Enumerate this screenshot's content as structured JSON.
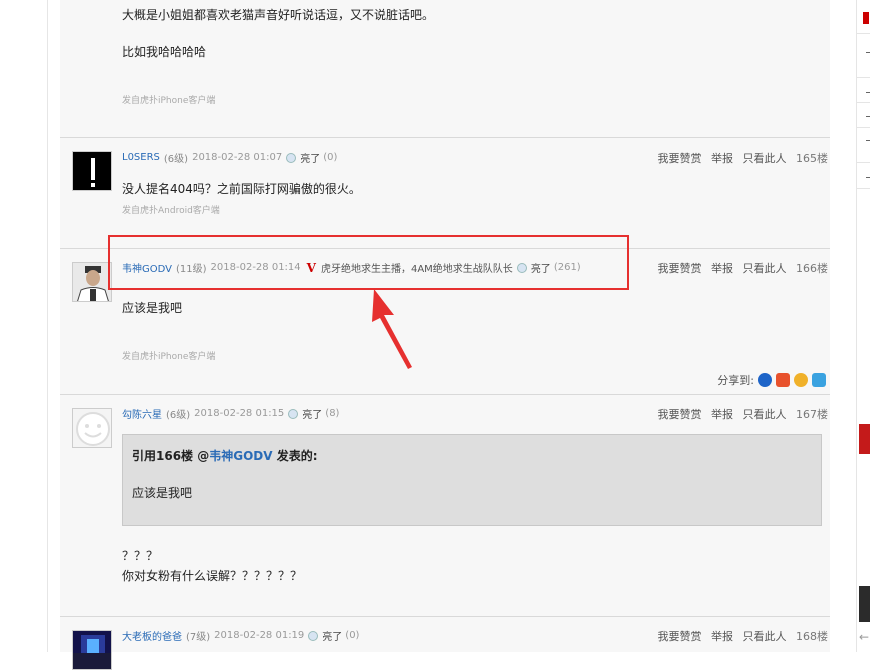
{
  "post_top": {
    "line1": "大概是小姐姐都喜欢老猫声音好听说话逗，又不说脏话吧。",
    "line2": "比如我哈哈哈哈",
    "source": "发自虎扑iPhone客户端"
  },
  "action_labels": {
    "reward": "我要赞赏",
    "report": "举报",
    "only_him": "只看此人"
  },
  "light_label": "亮了",
  "post_165": {
    "user": "L0SERS",
    "level": "(6级)",
    "time": "2018-02-28 01:07",
    "light_count": "(0)",
    "floor": "165楼",
    "content": "没人提名404吗？之前国际打网骗傲的很火。",
    "source": "发自虎扑Android客户端"
  },
  "post_166": {
    "user": "韦神GODV",
    "level": "(11级)",
    "time": "2018-02-28 01:14",
    "v_mark": "V",
    "honors": "虎牙绝地求生主播，4AM绝地求生战队队长",
    "light_count": "(261)",
    "floor": "166楼",
    "content": "应该是我吧",
    "source": "发自虎扑iPhone客户端",
    "share_label": "分享到:"
  },
  "post_167": {
    "user": "勾陈六星",
    "level": "(6级)",
    "time": "2018-02-28 01:15",
    "light_count": "(8)",
    "floor": "167楼",
    "quote_prefix": "引用166楼 @",
    "quote_user": "韦神GODV",
    "quote_suffix": " 发表的:",
    "quote_body": "应该是我吧",
    "line1": "？？？",
    "line2": "你对女粉有什么误解？？？？？？"
  },
  "post_168": {
    "user": "大老板的爸爸",
    "level": "(7级)",
    "time": "2018-02-28 01:19",
    "light_count": "(0)",
    "floor": "168楼"
  },
  "colors": {
    "annotation": "#e6302f",
    "link": "#2a6bb6"
  }
}
